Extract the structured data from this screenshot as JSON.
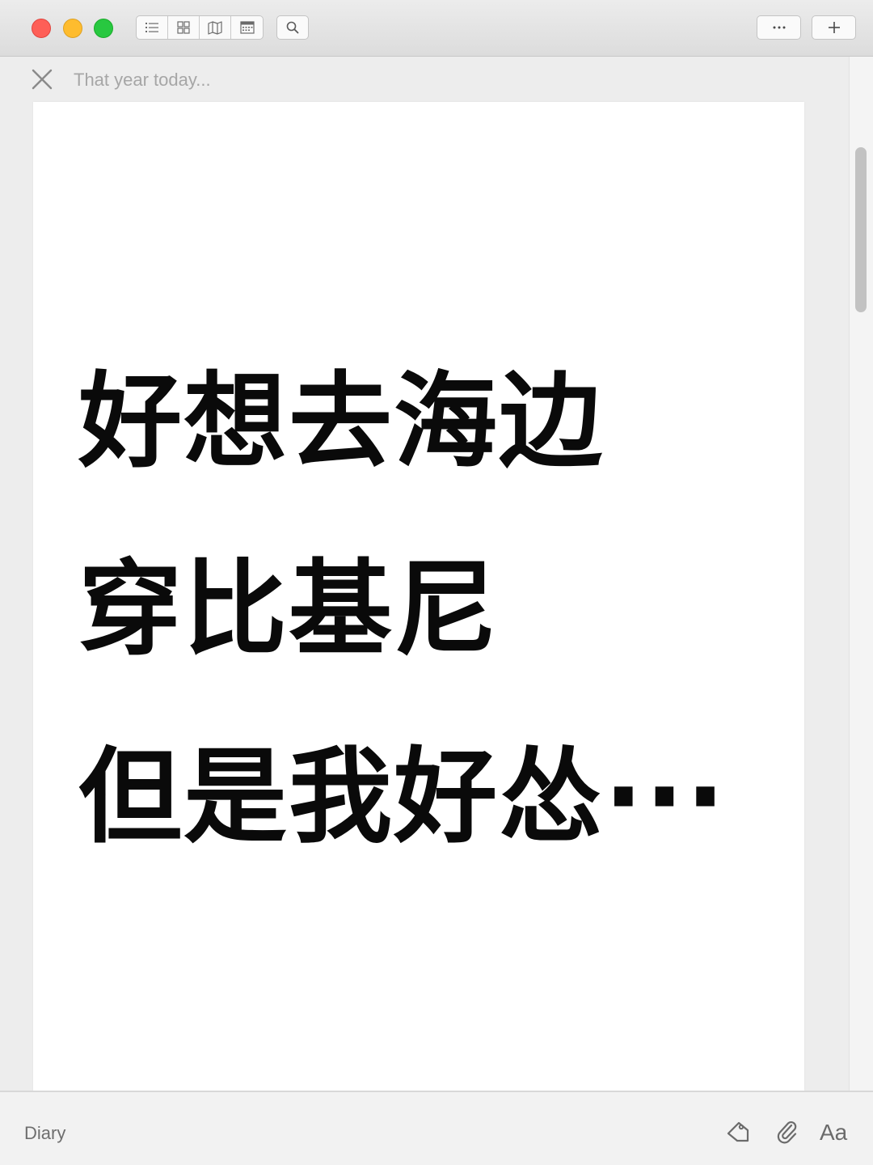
{
  "window": {
    "controls": [
      "close",
      "minimize",
      "zoom"
    ]
  },
  "toolbar": {
    "view_buttons": [
      {
        "name": "list-view",
        "icon": "list-icon"
      },
      {
        "name": "grid-view",
        "icon": "grid-icon"
      },
      {
        "name": "map-view",
        "icon": "map-icon"
      },
      {
        "name": "calendar-view",
        "icon": "calendar-icon"
      }
    ],
    "search_icon": "search-icon",
    "more_label": "···",
    "add_label": "+"
  },
  "entry": {
    "title": "That year today...",
    "lines": [
      "好想去海边",
      "穿比基尼",
      "但是我好怂···"
    ]
  },
  "footer": {
    "journal": "Diary",
    "tag_icon": "tag-icon",
    "attach_icon": "paperclip-icon",
    "font_label": "Aa"
  },
  "colors": {
    "traffic_close": "#fe5f57",
    "traffic_minimize": "#febc2e",
    "traffic_zoom": "#28c840",
    "window_bg": "#ededed",
    "page_bg": "#ffffff",
    "body_text": "#0a0a0a",
    "muted_text": "#a6a6a6"
  }
}
